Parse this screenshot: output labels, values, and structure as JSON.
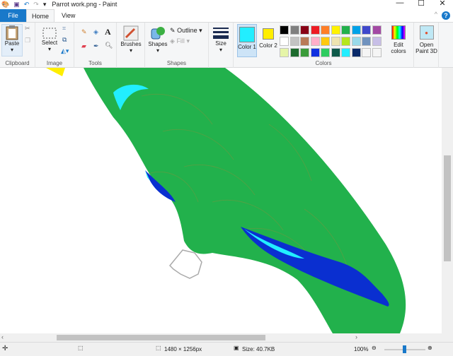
{
  "window": {
    "title": "Parrot work.png - Paint",
    "minimize": "—",
    "maximize": "☐",
    "close": "✕"
  },
  "tabs": [
    {
      "label": "File"
    },
    {
      "label": "Home"
    },
    {
      "label": "View"
    }
  ],
  "ribbon": {
    "clipboard": {
      "paste": "Paste",
      "label": "Clipboard"
    },
    "image": {
      "select": "Select",
      "label": "Image"
    },
    "tools": {
      "label": "Tools",
      "text_tool": "A"
    },
    "brushes": {
      "label": "Brushes"
    },
    "shapes": {
      "shapes": "Shapes",
      "outline": "Outline",
      "fill": "Fill",
      "label": "Shapes"
    },
    "size": {
      "label": "Size"
    },
    "colors": {
      "color1": "Color 1",
      "color2": "Color 2",
      "color1_value": "#22eeff",
      "color2_value": "#ffee00",
      "edit": "Edit colors",
      "label": "Colors",
      "palette": [
        "#000000",
        "#7f7f7f",
        "#880015",
        "#ed1c24",
        "#ff7f27",
        "#fff200",
        "#22b14c",
        "#00a2e8",
        "#3f48cc",
        "#a349a4",
        "#ffffff",
        "#c3c3c3",
        "#b97a57",
        "#ffaec9",
        "#ffc90e",
        "#efe4b0",
        "#b5e61d",
        "#99d9ea",
        "#7092be",
        "#c8bfe7",
        "#e6f5a8",
        "#1d6b2e",
        "#3a9b3a",
        "#1030e0",
        "#2ecc60",
        "#0e5a4a",
        "#22eeff",
        "#0a2a6a",
        "#f5f5f5",
        "#f5f5f5"
      ]
    },
    "paint3d": {
      "label": "Open Paint 3D"
    }
  },
  "status": {
    "dimensions": "1480 × 1256px",
    "size": "Size: 40.7KB",
    "zoom": "100%"
  }
}
